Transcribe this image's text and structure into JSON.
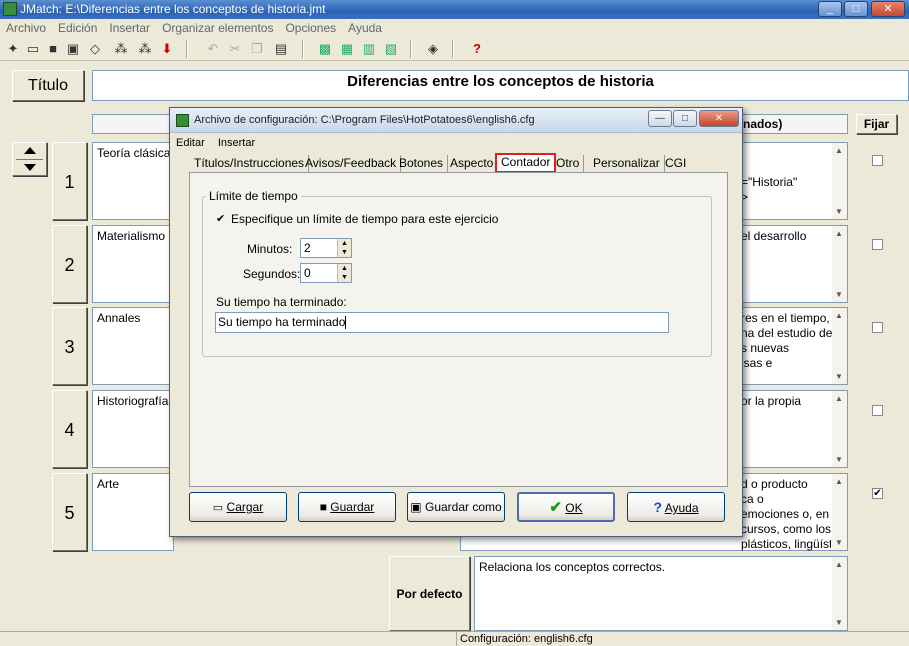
{
  "window": {
    "title": "JMatch: E:\\Diferencias entre los conceptos de historia.jmt"
  },
  "menubar": [
    "Archivo",
    "Edición",
    "Insertar",
    "Organizar elementos",
    "Opciones",
    "Ayuda"
  ],
  "main": {
    "title_button": "Título",
    "title_value": "Diferencias entre los conceptos de historia",
    "right_header": "nados)",
    "fijar_label": "Fijar",
    "rows": [
      {
        "num": "1",
        "left": "Teoría clásica",
        "right": "=\"Historia\"\n>",
        "fixed": false
      },
      {
        "num": "2",
        "left": "Materialismo h",
        "right": "el desarrollo",
        "fixed": false
      },
      {
        "num": "3",
        "left": "Annales",
        "right": "res en el tiempo,\nna del estudio de\ns nuevas\nisas e",
        "fixed": false
      },
      {
        "num": "4",
        "left": "Historiografía",
        "right": "or la propia",
        "fixed": false
      },
      {
        "num": "5",
        "left": "Arte",
        "right": "d o producto\nca o\nemociones o, en\ncursos, como los\nplásticos, lingüísticos, sonoros o mixtos.",
        "fixed": true
      }
    ],
    "default_label": "Por defecto",
    "default_value": "Relaciona los conceptos correctos."
  },
  "dialog": {
    "title": "Archivo de configuración: C:\\Program Files\\HotPotatoes6\\english6.cfg",
    "menu": [
      "Editar",
      "Insertar"
    ],
    "tabs": [
      "Títulos/Instrucciones",
      "Avisos/Feedback",
      "Botones",
      "Aspecto",
      "Contador",
      "Otro",
      "Personalizar",
      "CGI"
    ],
    "active_tab": "Contador",
    "group_label": "Límite de tiempo",
    "checkbox_label": "Especifique un límite de tiempo para este ejercicio",
    "checkbox_checked": true,
    "minutes_label": "Minutos:",
    "minutes_value": "2",
    "seconds_label": "Segundos:",
    "seconds_value": "0",
    "timeout_label": "Su tiempo ha terminado:",
    "timeout_value": "Su tiempo ha terminado",
    "buttons": {
      "load": "Cargar",
      "save": "Guardar",
      "save_as": "Guardar como",
      "ok": "OK",
      "help": "Ayuda"
    }
  },
  "status": {
    "text": "Configuración: english6.cfg"
  }
}
